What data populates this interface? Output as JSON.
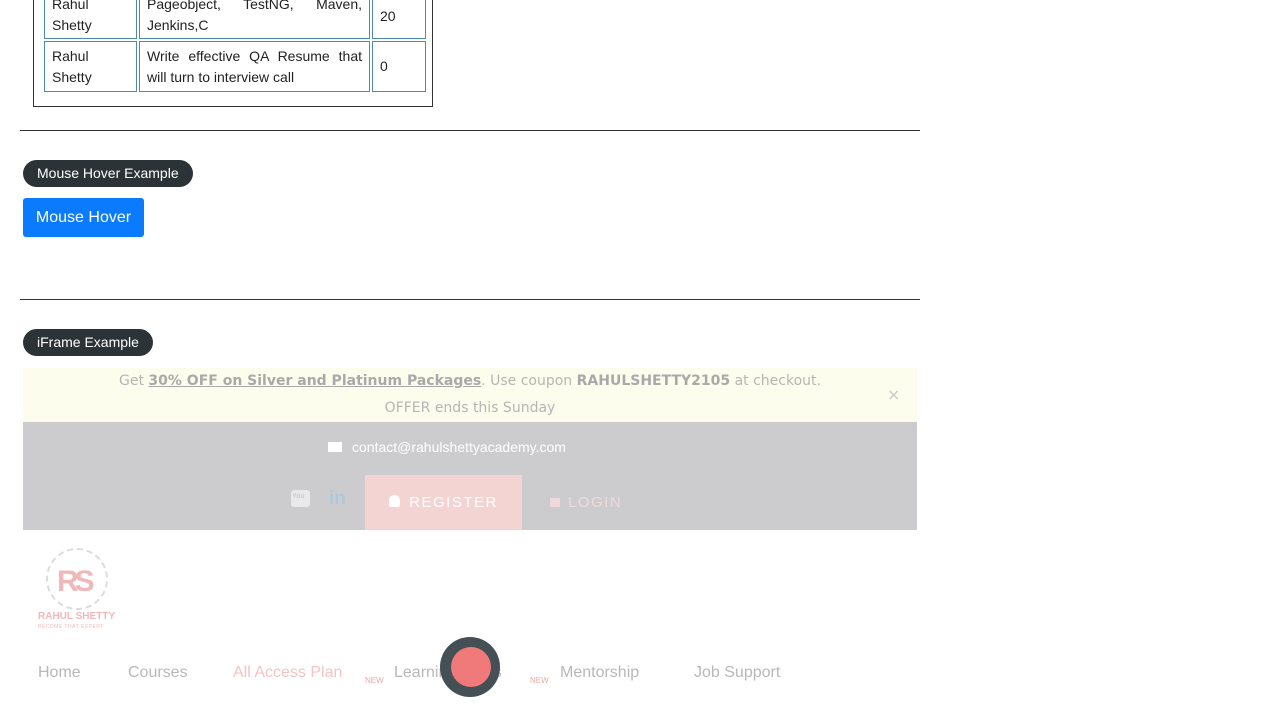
{
  "web_table": {
    "rows": [
      {
        "instructor": "Rahul Shetty",
        "course": "Pageobject, TestNG, Maven, Jenkins,C",
        "price": "20"
      },
      {
        "instructor": "Rahul Shetty",
        "course": "Write effective QA Resume that will turn to interview call",
        "price": "0"
      }
    ]
  },
  "mouse_hover": {
    "legend": "Mouse Hover Example",
    "button_label": "Mouse Hover"
  },
  "iframe_section": {
    "legend": "iFrame Example"
  },
  "iframe": {
    "offer": {
      "prefix": "Get ",
      "link": "30% OFF on Silver and Platinum Packages",
      "middle": ". Use coupon ",
      "coupon": "RAHULSHETTY2105",
      "suffix": " at checkout.",
      "line2": "OFFER ends this Sunday",
      "close_glyph": "×"
    },
    "contact_email": "contact@rahulshettyacademy.com",
    "register_label": "REGISTER",
    "login_label": "LOGIN",
    "logo": {
      "mark": "RS",
      "name": "RAHUL SHETTY",
      "tagline": "BECOME THAT EXPERT"
    },
    "nav": {
      "items": [
        "Home",
        "Courses",
        "All Access Plan",
        "Learning Paths",
        "Mentorship",
        "Job Support"
      ],
      "badge": "NEW",
      "active": "All Access Plan"
    }
  },
  "colors": {
    "legend_bg": "#2c3337",
    "hover_button_bg": "#0a7bff",
    "table_border": "#4a8ab3",
    "offer_bar_bg": "#fdfdee",
    "iframe_topbar_bg": "#ccccce",
    "register_bg": "#f4d3d3",
    "brand_pink": "#f07a7a"
  },
  "icons": [
    "mail-icon",
    "youtube-icon",
    "linkedin-icon",
    "user-icon",
    "lock-icon",
    "close-icon",
    "loading-spinner"
  ]
}
